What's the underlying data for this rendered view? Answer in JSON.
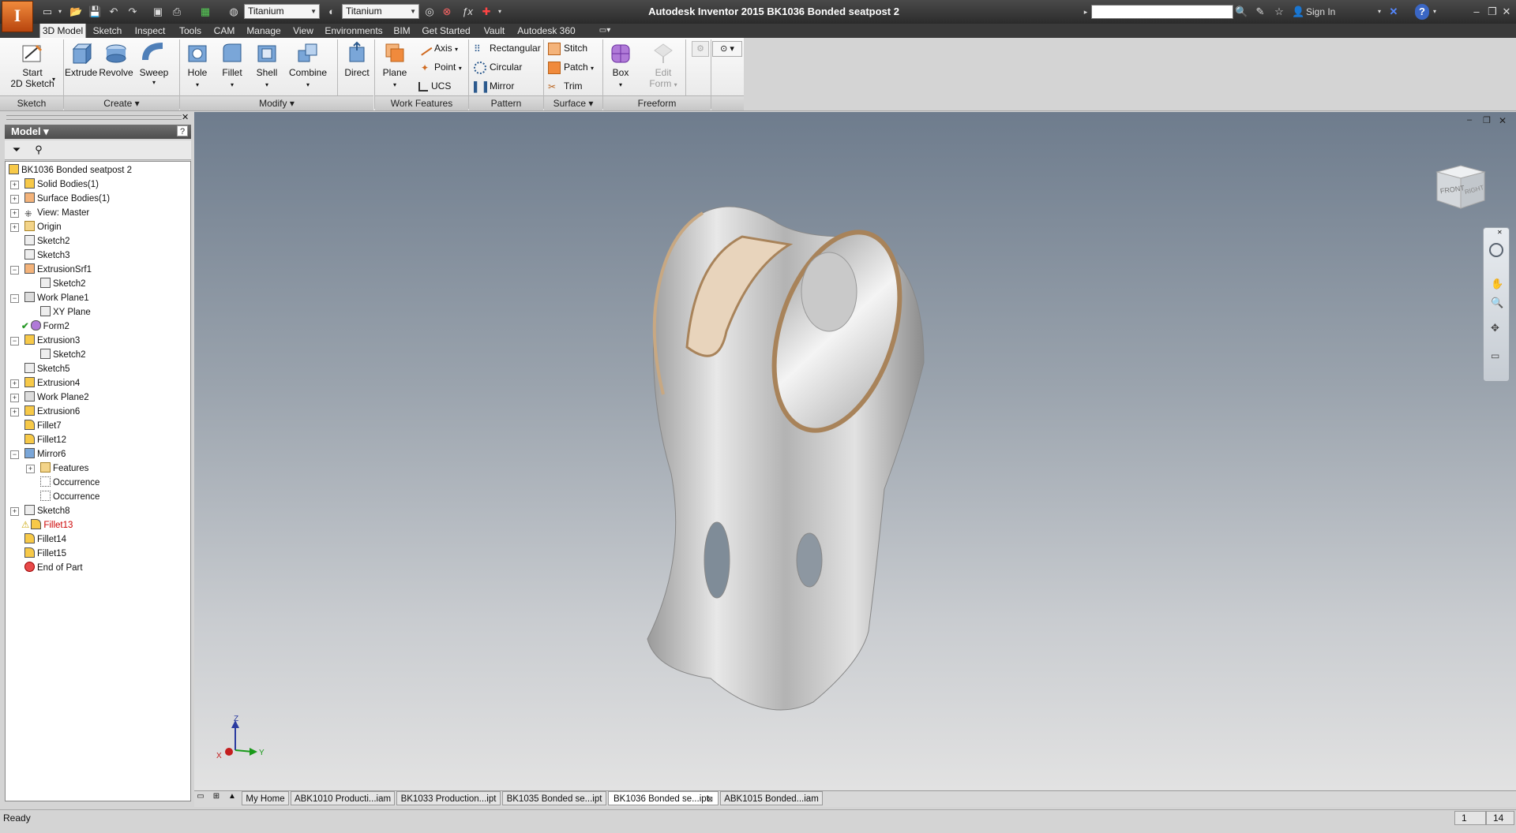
{
  "app": {
    "title": "Autodesk Inventor 2015   BK1036 Bonded seatpost 2",
    "logo_letter": "I"
  },
  "quick_access": {
    "material": "Titanium",
    "appearance": "Titanium",
    "sign_in": "Sign In"
  },
  "ribbon_tabs": [
    "3D Model",
    "Sketch",
    "Inspect",
    "Tools",
    "CAM",
    "Manage",
    "View",
    "Environments",
    "BIM",
    "Get Started",
    "Vault",
    "Autodesk 360"
  ],
  "ribbon": {
    "start_sketch": "Start\n2D Sketch",
    "start_sketch_l1": "Start",
    "start_sketch_l2": "2D Sketch",
    "extrude": "Extrude",
    "revolve": "Revolve",
    "sweep": "Sweep",
    "hole": "Hole",
    "fillet": "Fillet",
    "shell": "Shell",
    "combine": "Combine",
    "direct": "Direct",
    "plane": "Plane",
    "axis": "Axis",
    "point": "Point",
    "ucs": "UCS",
    "rectangular": "Rectangular",
    "circular": "Circular",
    "mirror": "Mirror",
    "stitch": "Stitch",
    "patch": "Patch",
    "trim": "Trim",
    "box": "Box",
    "edit_form_l1": "Edit",
    "edit_form_l2": "Form",
    "panels": {
      "sketch": "Sketch",
      "create": "Create",
      "modify": "Modify",
      "work_features": "Work Features",
      "pattern": "Pattern",
      "surface": "Surface",
      "freeform": "Freeform"
    }
  },
  "browser": {
    "header": "Model",
    "tree": [
      {
        "label": "BK1036 Bonded seatpost 2",
        "depth": 0
      },
      {
        "label": "Solid Bodies(1)",
        "depth": 1
      },
      {
        "label": "Surface Bodies(1)",
        "depth": 1
      },
      {
        "label": "View: Master",
        "depth": 1
      },
      {
        "label": "Origin",
        "depth": 1
      },
      {
        "label": "Sketch2",
        "depth": 1
      },
      {
        "label": "Sketch3",
        "depth": 1
      },
      {
        "label": "ExtrusionSrf1",
        "depth": 1
      },
      {
        "label": "Sketch2",
        "depth": 2
      },
      {
        "label": "Work Plane1",
        "depth": 1
      },
      {
        "label": "XY Plane",
        "depth": 2
      },
      {
        "label": "Form2",
        "depth": 1
      },
      {
        "label": "Extrusion3",
        "depth": 1
      },
      {
        "label": "Sketch2",
        "depth": 2
      },
      {
        "label": "Sketch5",
        "depth": 1
      },
      {
        "label": "Extrusion4",
        "depth": 1
      },
      {
        "label": "Work Plane2",
        "depth": 1
      },
      {
        "label": "Extrusion6",
        "depth": 1
      },
      {
        "label": "Fillet7",
        "depth": 1
      },
      {
        "label": "Fillet12",
        "depth": 1
      },
      {
        "label": "Mirror6",
        "depth": 1
      },
      {
        "label": "Features",
        "depth": 2
      },
      {
        "label": "Occurrence",
        "depth": 2
      },
      {
        "label": "Occurrence",
        "depth": 2
      },
      {
        "label": "Sketch8",
        "depth": 1
      },
      {
        "label": "Fillet13",
        "depth": 1
      },
      {
        "label": "Fillet14",
        "depth": 1
      },
      {
        "label": "Fillet15",
        "depth": 1
      },
      {
        "label": "End of Part",
        "depth": 1
      }
    ]
  },
  "viewcube": {
    "front": "FRONT",
    "right": "RIGHT"
  },
  "triad": {
    "x": "X",
    "y": "Y",
    "z": "Z"
  },
  "doc_tabs": [
    "My Home",
    "ABK1010 Producti...iam",
    "BK1033 Production...ipt",
    "BK1035 Bonded se...ipt",
    "BK1036 Bonded se...ipt",
    "ABK1015 Bonded...iam"
  ],
  "status": {
    "text": "Ready",
    "box1": "1",
    "box2": "14"
  },
  "colors": {
    "accent": "#f07c2a",
    "warning": "#cc0000",
    "check": "#2a9a2a"
  }
}
